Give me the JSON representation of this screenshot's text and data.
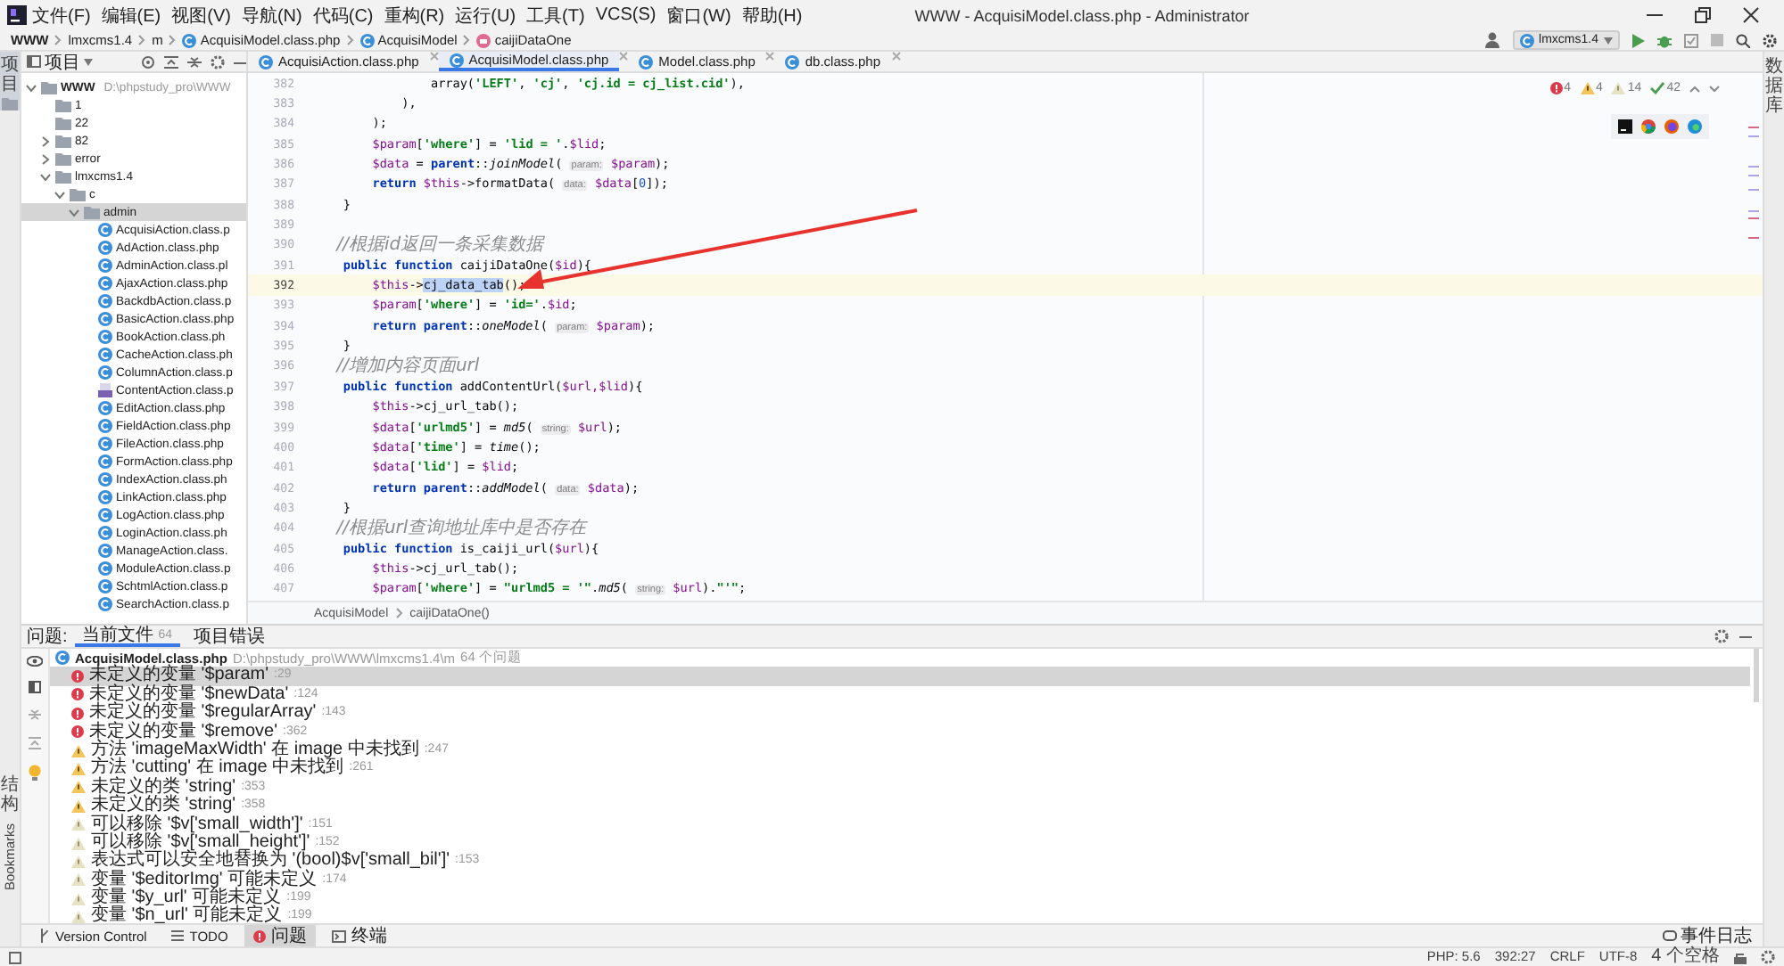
{
  "menu_bar": {
    "items": [
      "文件(F)",
      "编辑(E)",
      "视图(V)",
      "导航(N)",
      "代码(C)",
      "重构(R)",
      "运行(U)",
      "工具(T)",
      "VCS(S)",
      "窗口(W)",
      "帮助(H)"
    ],
    "title": "WWW - AcquisiModel.class.php - Administrator"
  },
  "breadcrumb": [
    {
      "text": "WWW",
      "kind": "project"
    },
    {
      "text": "lmxcms1.4",
      "kind": "folder"
    },
    {
      "text": "m",
      "kind": "folder"
    },
    {
      "text": "AcquisiModel.class.php",
      "kind": "class"
    },
    {
      "text": "AcquisiModel",
      "kind": "class"
    },
    {
      "text": "caijiDataOne",
      "kind": "method"
    }
  ],
  "run_config": "lmxcms1.4",
  "side_labels": {
    "left_top": "项目",
    "left_bottom": [
      "结构",
      "Bookmarks"
    ],
    "right": "数据库"
  },
  "project_panel": {
    "title": "项目"
  },
  "editor_tabs": [
    {
      "label": "AcquisiAction.class.php",
      "selected": false
    },
    {
      "label": "AcquisiModel.class.php",
      "selected": true
    },
    {
      "label": "Model.class.php",
      "selected": false
    },
    {
      "label": "db.class.php",
      "selected": false
    }
  ],
  "tree": [
    {
      "label": "WWW",
      "path": "D:\\phpstudy_pro\\WWW",
      "kind": "folder",
      "expanded": true,
      "selected": false,
      "children": [
        {
          "label": "1",
          "kind": "folder",
          "selected": false
        },
        {
          "label": "22",
          "kind": "folder",
          "selected": false
        },
        {
          "label": "82",
          "kind": "folder",
          "expanded": false,
          "selected": false
        },
        {
          "label": "error",
          "kind": "folder",
          "expanded": false,
          "selected": false
        },
        {
          "label": "lmxcms1.4",
          "kind": "folder",
          "expanded": true,
          "selected": false,
          "children": [
            {
              "label": "c",
              "kind": "folder",
              "expanded": true,
              "selected": false,
              "children": [
                {
                  "label": "admin",
                  "kind": "folder",
                  "expanded": true,
                  "selected": true,
                  "children": [
                    {
                      "label": "AcquisiAction.class.p",
                      "kind": "class",
                      "selected": false
                    },
                    {
                      "label": "AdAction.class.php",
                      "kind": "class",
                      "selected": false
                    },
                    {
                      "label": "AdminAction.class.pl",
                      "kind": "class",
                      "selected": false
                    },
                    {
                      "label": "AjaxAction.class.php",
                      "kind": "class",
                      "selected": false
                    },
                    {
                      "label": "BackdbAction.class.p",
                      "kind": "class",
                      "selected": false
                    },
                    {
                      "label": "BasicAction.class.php",
                      "kind": "class",
                      "selected": false
                    },
                    {
                      "label": "BookAction.class.ph",
                      "kind": "class",
                      "selected": false
                    },
                    {
                      "label": "CacheAction.class.ph",
                      "kind": "class",
                      "selected": false
                    },
                    {
                      "label": "ColumnAction.class.p",
                      "kind": "class",
                      "selected": false
                    },
                    {
                      "label": "ContentAction.class.p",
                      "kind": "php",
                      "selected": false
                    },
                    {
                      "label": "EditAction.class.php",
                      "kind": "class",
                      "selected": false
                    },
                    {
                      "label": "FieldAction.class.php",
                      "kind": "class",
                      "selected": false
                    },
                    {
                      "label": "FileAction.class.php",
                      "kind": "class",
                      "selected": false
                    },
                    {
                      "label": "FormAction.class.php",
                      "kind": "class",
                      "selected": false
                    },
                    {
                      "label": "IndexAction.class.ph",
                      "kind": "class",
                      "selected": false
                    },
                    {
                      "label": "LinkAction.class.php",
                      "kind": "class",
                      "selected": false
                    },
                    {
                      "label": "LogAction.class.php",
                      "kind": "class",
                      "selected": false
                    },
                    {
                      "label": "LoginAction.class.ph",
                      "kind": "class",
                      "selected": false
                    },
                    {
                      "label": "ManageAction.class.",
                      "kind": "class",
                      "selected": false
                    },
                    {
                      "label": "ModuleAction.class.p",
                      "kind": "class",
                      "selected": false
                    },
                    {
                      "label": "SchtmlAction.class.p",
                      "kind": "class",
                      "selected": false
                    },
                    {
                      "label": "SearchAction.class.p",
                      "kind": "class",
                      "selected": false
                    }
                  ]
                }
              ]
            }
          ]
        }
      ]
    }
  ],
  "editor": {
    "inspections": [
      {
        "kind": "error",
        "count": "4"
      },
      {
        "kind": "warning",
        "count": "4"
      },
      {
        "kind": "weak",
        "count": "14"
      },
      {
        "kind": "typo",
        "count": "42"
      }
    ],
    "lines": [
      {
        "number": "382",
        "current": false,
        "tokens": [
          {
            "kind": "text",
            "text": "                array("
          },
          {
            "kind": "str",
            "text": "'LEFT'"
          },
          {
            "kind": "text",
            "text": ", "
          },
          {
            "kind": "str",
            "text": "'cj'"
          },
          {
            "kind": "text",
            "text": ", "
          },
          {
            "kind": "str",
            "text": "'cj.id = cj_list.cid'"
          },
          {
            "kind": "text",
            "text": "),"
          }
        ]
      },
      {
        "number": "383",
        "current": false,
        "tokens": [
          {
            "kind": "text",
            "text": "            ),"
          }
        ]
      },
      {
        "number": "384",
        "current": false,
        "tokens": [
          {
            "kind": "text",
            "text": "        );"
          }
        ]
      },
      {
        "number": "385",
        "current": false,
        "tokens": [
          {
            "kind": "var",
            "text": "        $param"
          },
          {
            "kind": "text",
            "text": "["
          },
          {
            "kind": "str",
            "text": "'where'"
          },
          {
            "kind": "text",
            "text": "] = "
          },
          {
            "kind": "str",
            "text": "'lid = '"
          },
          {
            "kind": "text",
            "text": "."
          },
          {
            "kind": "var",
            "text": "$lid"
          },
          {
            "kind": "text",
            "text": ";"
          }
        ]
      },
      {
        "number": "386",
        "current": false,
        "tokens": [
          {
            "kind": "var",
            "text": "        $data"
          },
          {
            "kind": "text",
            "text": " = "
          },
          {
            "kind": "kw",
            "text": "parent"
          },
          {
            "kind": "text",
            "text": "::"
          },
          {
            "kind": "static",
            "text": "joinModel"
          },
          {
            "kind": "text",
            "text": "( "
          },
          {
            "kind": "hint",
            "text": "param:"
          },
          {
            "kind": "var",
            "text": " $param"
          },
          {
            "kind": "text",
            "text": ");"
          }
        ]
      },
      {
        "number": "387",
        "current": false,
        "tokens": [
          {
            "kind": "kw",
            "text": "        return "
          },
          {
            "kind": "var",
            "text": "$this"
          },
          {
            "kind": "text",
            "text": "->formatData( "
          },
          {
            "kind": "hint",
            "text": "data:"
          },
          {
            "kind": "var",
            "text": " $data"
          },
          {
            "kind": "text",
            "text": "["
          },
          {
            "kind": "num",
            "text": "0"
          },
          {
            "kind": "text",
            "text": "]);"
          }
        ]
      },
      {
        "number": "388",
        "current": false,
        "tokens": [
          {
            "kind": "text",
            "text": "    }"
          }
        ]
      },
      {
        "number": "389",
        "current": false
      },
      {
        "number": "390",
        "current": false,
        "tokens": [
          {
            "kind": "comment",
            "text": "    //根据id返回一条采集数据"
          }
        ]
      },
      {
        "number": "391",
        "current": false,
        "tokens": [
          {
            "kind": "kw",
            "text": "    public function "
          },
          {
            "kind": "text",
            "text": "caijiDataOne("
          },
          {
            "kind": "var",
            "text": "$id"
          },
          {
            "kind": "text",
            "text": "){"
          }
        ]
      },
      {
        "number": "392",
        "current": true,
        "tokens": [
          {
            "kind": "var",
            "text": "        $this"
          },
          {
            "kind": "text",
            "text": "->"
          },
          {
            "kind": "sel",
            "text": "cj_data_tab"
          },
          {
            "kind": "text",
            "text": "();"
          }
        ]
      },
      {
        "number": "393",
        "current": false,
        "tokens": [
          {
            "kind": "var",
            "text": "        $param"
          },
          {
            "kind": "text",
            "text": "["
          },
          {
            "kind": "str",
            "text": "'where'"
          },
          {
            "kind": "text",
            "text": "] = "
          },
          {
            "kind": "str",
            "text": "'id='"
          },
          {
            "kind": "text",
            "text": "."
          },
          {
            "kind": "var",
            "text": "$id"
          },
          {
            "kind": "text",
            "text": ";"
          }
        ]
      },
      {
        "number": "394",
        "current": false,
        "tokens": [
          {
            "kind": "kw",
            "text": "        return parent"
          },
          {
            "kind": "text",
            "text": "::"
          },
          {
            "kind": "static",
            "text": "oneModel"
          },
          {
            "kind": "text",
            "text": "( "
          },
          {
            "kind": "hint",
            "text": "param:"
          },
          {
            "kind": "var",
            "text": " $param"
          },
          {
            "kind": "text",
            "text": ");"
          }
        ]
      },
      {
        "number": "395",
        "current": false,
        "tokens": [
          {
            "kind": "text",
            "text": "    }"
          }
        ]
      },
      {
        "number": "396",
        "current": false,
        "tokens": [
          {
            "kind": "comment",
            "text": "    //增加内容页面url"
          }
        ]
      },
      {
        "number": "397",
        "current": false,
        "tokens": [
          {
            "kind": "kw",
            "text": "    public function "
          },
          {
            "kind": "text",
            "text": "addContentUrl("
          },
          {
            "kind": "var",
            "text": "$url,$lid"
          },
          {
            "kind": "text",
            "text": "){"
          }
        ]
      },
      {
        "number": "398",
        "current": false,
        "tokens": [
          {
            "kind": "var",
            "text": "        $this"
          },
          {
            "kind": "text",
            "text": "->cj_url_tab();"
          }
        ]
      },
      {
        "number": "399",
        "current": false,
        "tokens": [
          {
            "kind": "var",
            "text": "        $data"
          },
          {
            "kind": "text",
            "text": "["
          },
          {
            "kind": "str",
            "text": "'urlmd5'"
          },
          {
            "kind": "text",
            "text": "] = "
          },
          {
            "kind": "static",
            "text": "md5"
          },
          {
            "kind": "text",
            "text": "( "
          },
          {
            "kind": "hint",
            "text": "string:"
          },
          {
            "kind": "var",
            "text": " $url"
          },
          {
            "kind": "text",
            "text": ");"
          }
        ]
      },
      {
        "number": "400",
        "current": false,
        "tokens": [
          {
            "kind": "var",
            "text": "        $data"
          },
          {
            "kind": "text",
            "text": "["
          },
          {
            "kind": "str",
            "text": "'time'"
          },
          {
            "kind": "text",
            "text": "] = "
          },
          {
            "kind": "static",
            "text": "time"
          },
          {
            "kind": "text",
            "text": "();"
          }
        ]
      },
      {
        "number": "401",
        "current": false,
        "tokens": [
          {
            "kind": "var",
            "text": "        $data"
          },
          {
            "kind": "text",
            "text": "["
          },
          {
            "kind": "str",
            "text": "'lid'"
          },
          {
            "kind": "text",
            "text": "] = "
          },
          {
            "kind": "var",
            "text": "$lid"
          },
          {
            "kind": "text",
            "text": ";"
          }
        ]
      },
      {
        "number": "402",
        "current": false,
        "tokens": [
          {
            "kind": "kw",
            "text": "        return parent"
          },
          {
            "kind": "text",
            "text": "::"
          },
          {
            "kind": "static",
            "text": "addModel"
          },
          {
            "kind": "text",
            "text": "( "
          },
          {
            "kind": "hint",
            "text": "data:"
          },
          {
            "kind": "var",
            "text": " $data"
          },
          {
            "kind": "text",
            "text": ");"
          }
        ]
      },
      {
        "number": "403",
        "current": false,
        "tokens": [
          {
            "kind": "text",
            "text": "    }"
          }
        ]
      },
      {
        "number": "404",
        "current": false,
        "tokens": [
          {
            "kind": "comment",
            "text": "    //根据url查询地址库中是否存在"
          }
        ]
      },
      {
        "number": "405",
        "current": false,
        "tokens": [
          {
            "kind": "kw",
            "text": "    public function "
          },
          {
            "kind": "text",
            "text": "is_caiji_url("
          },
          {
            "kind": "var",
            "text": "$url"
          },
          {
            "kind": "text",
            "text": "){"
          }
        ]
      },
      {
        "number": "406",
        "current": false,
        "tokens": [
          {
            "kind": "var",
            "text": "        $this"
          },
          {
            "kind": "text",
            "text": "->cj_url_tab();"
          }
        ]
      },
      {
        "number": "407",
        "current": false,
        "tokens": [
          {
            "kind": "var",
            "text": "        $param"
          },
          {
            "kind": "text",
            "text": "["
          },
          {
            "kind": "str",
            "text": "'where'"
          },
          {
            "kind": "text",
            "text": "] = "
          },
          {
            "kind": "str",
            "text": "\"urlmd5 = '\""
          },
          {
            "kind": "text",
            "text": "."
          },
          {
            "kind": "static",
            "text": "md5"
          },
          {
            "kind": "text",
            "text": "( "
          },
          {
            "kind": "hint",
            "text": "string:"
          },
          {
            "kind": "var",
            "text": " $url"
          },
          {
            "kind": "text",
            "text": ")."
          },
          {
            "kind": "str",
            "text": "\"'\""
          },
          {
            "kind": "text",
            "text": ";"
          }
        ]
      }
    ],
    "breadcrumb": [
      "AcquisiModel",
      "caijiDataOne()"
    ]
  },
  "problems": {
    "title": "问题:",
    "tabs": [
      {
        "label": "当前文件",
        "count": "64",
        "selected": true
      },
      {
        "label": "项目错误",
        "selected": false
      }
    ],
    "file": {
      "name": "AcquisiModel.class.php",
      "path": "D:\\phpstudy_pro\\WWW\\lmxcms1.4\\m",
      "count": "64 个问题"
    },
    "items": [
      {
        "kind": "error",
        "text": "未定义的变量 '$param'",
        "line": ":29",
        "selected": true
      },
      {
        "kind": "error",
        "text": "未定义的变量 '$newData'",
        "line": ":124",
        "selected": false
      },
      {
        "kind": "error",
        "text": "未定义的变量 '$regularArray'",
        "line": ":143",
        "selected": false
      },
      {
        "kind": "error",
        "text": "未定义的变量 '$remove'",
        "line": ":362",
        "selected": false
      },
      {
        "kind": "warning",
        "text": "方法 'imageMaxWidth' 在 image 中未找到",
        "line": ":247",
        "selected": false
      },
      {
        "kind": "warning",
        "text": "方法 'cutting' 在 image 中未找到",
        "line": ":261",
        "selected": false
      },
      {
        "kind": "warning",
        "text": "未定义的类 'string'",
        "line": ":353",
        "selected": false
      },
      {
        "kind": "warning",
        "text": "未定义的类 'string'",
        "line": ":358",
        "selected": false
      },
      {
        "kind": "weak",
        "text": "可以移除 '$v['small_width']'",
        "line": ":151",
        "selected": false
      },
      {
        "kind": "weak",
        "text": "可以移除 '$v['small_height']'",
        "line": ":152",
        "selected": false
      },
      {
        "kind": "weak",
        "text": "表达式可以安全地替换为 '(bool)$v['small_bil']'",
        "line": ":153",
        "selected": false
      },
      {
        "kind": "weak",
        "text": "变量 '$editorImg' 可能未定义",
        "line": ":174",
        "selected": false
      },
      {
        "kind": "weak",
        "text": "变量 '$y_url' 可能未定义",
        "line": ":199",
        "selected": false
      },
      {
        "kind": "weak",
        "text": "变量 '$n_url' 可能未定义",
        "line": ":199",
        "selected": false
      }
    ]
  },
  "tool_windows": [
    {
      "label": "Version Control",
      "kind": "vcs",
      "selected": false
    },
    {
      "label": "TODO",
      "kind": "todo",
      "selected": false
    },
    {
      "label": "问题",
      "kind": "problems",
      "selected": true
    },
    {
      "label": "终端",
      "kind": "terminal",
      "selected": false
    }
  ],
  "event_log": "事件日志",
  "status": [
    "PHP: 5.6",
    "392:27",
    "CRLF",
    "UTF-8",
    "4 个空格"
  ]
}
